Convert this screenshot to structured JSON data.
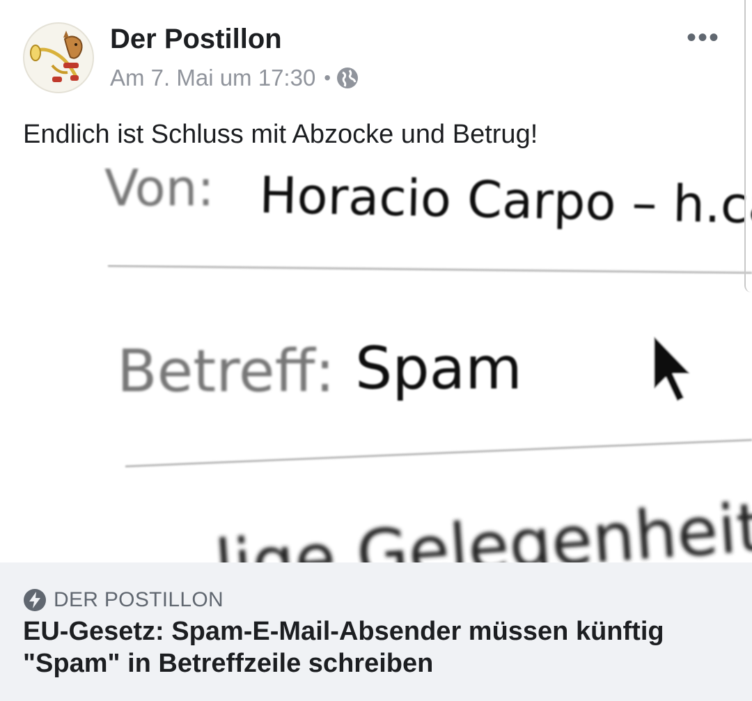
{
  "post": {
    "page_name": "Der Postillon",
    "timestamp": "Am 7. Mai um 17:30",
    "separator": "•",
    "privacy_icon": "globe-icon",
    "more_label": "•••",
    "caption": "Endlich ist Schluss mit Abzocke und Betrug!"
  },
  "link_image": {
    "from_label": "Von:",
    "from_value": "Horacio Carpo – h.ca",
    "subject_label": "Betreff:",
    "subject_value": "Spam",
    "body_fragment": "...lige Gelegenheit!",
    "cursor_icon": "mouse-pointer-icon"
  },
  "link_preview": {
    "source_icon": "instant-article-bolt-icon",
    "source": "DER POSTILLON",
    "headline": "EU-Gesetz: Spam-E-Mail-Absender müssen künftig \"Spam\" in Betreffzeile schreiben"
  },
  "colors": {
    "text_primary": "#1c1e21",
    "text_secondary": "#90949c",
    "footer_bg": "#f0f2f5"
  }
}
